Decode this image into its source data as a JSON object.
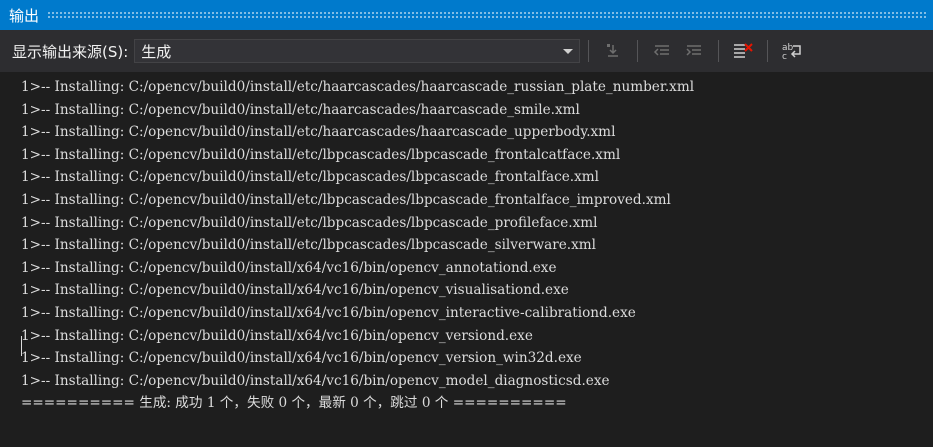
{
  "panel": {
    "title": "输出"
  },
  "toolbar": {
    "source_label": "显示输出来源(S):",
    "source_value": "生成",
    "buttons": [
      {
        "name": "go-to-line-icon"
      },
      {
        "name": "previous-message-icon"
      },
      {
        "name": "next-message-icon"
      },
      {
        "name": "clear-all-icon"
      },
      {
        "name": "word-wrap-icon"
      }
    ]
  },
  "output": {
    "lines": [
      "1>-- Installing: C:/opencv/build0/install/etc/haarcascades/haarcascade_russian_plate_number.xml",
      "1>-- Installing: C:/opencv/build0/install/etc/haarcascades/haarcascade_smile.xml",
      "1>-- Installing: C:/opencv/build0/install/etc/haarcascades/haarcascade_upperbody.xml",
      "1>-- Installing: C:/opencv/build0/install/etc/lbpcascades/lbpcascade_frontalcatface.xml",
      "1>-- Installing: C:/opencv/build0/install/etc/lbpcascades/lbpcascade_frontalface.xml",
      "1>-- Installing: C:/opencv/build0/install/etc/lbpcascades/lbpcascade_frontalface_improved.xml",
      "1>-- Installing: C:/opencv/build0/install/etc/lbpcascades/lbpcascade_profileface.xml",
      "1>-- Installing: C:/opencv/build0/install/etc/lbpcascades/lbpcascade_silverware.xml",
      "1>-- Installing: C:/opencv/build0/install/x64/vc16/bin/opencv_annotationd.exe",
      "1>-- Installing: C:/opencv/build0/install/x64/vc16/bin/opencv_visualisationd.exe",
      "1>-- Installing: C:/opencv/build0/install/x64/vc16/bin/opencv_interactive-calibrationd.exe",
      "1>-- Installing: C:/opencv/build0/install/x64/vc16/bin/opencv_versiond.exe",
      "1>-- Installing: C:/opencv/build0/install/x64/vc16/bin/opencv_version_win32d.exe",
      "1>-- Installing: C:/opencv/build0/install/x64/vc16/bin/opencv_model_diagnosticsd.exe",
      "========== 生成: 成功 1 个，失败 0 个，最新 0 个，跳过 0 个 =========="
    ]
  },
  "colors": {
    "title_bar": "#007acc",
    "toolbar": "#2d2d30",
    "background": "#1e1e1e",
    "text": "#dcdcdc"
  }
}
